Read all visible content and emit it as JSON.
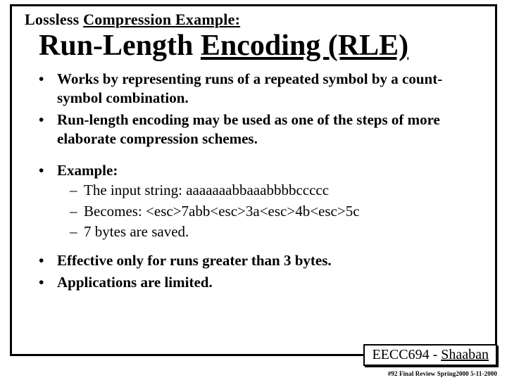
{
  "supertitle_plain": "Lossless ",
  "supertitle_under": "Compression Example:",
  "title_plain": "Run-Length ",
  "title_under": "Encoding (RLE)",
  "bullets": {
    "b1": "Works by representing runs of a repeated symbol by a count-symbol combination.",
    "b2": "Run-length encoding may be used as one of the steps of more elaborate compression schemes.",
    "b3": "Example:",
    "b3_sub": {
      "s1": "The input string:   aaaaaaabbaaabbbbccccc",
      "s2": "Becomes: <esc>7abb<esc>3a<esc>4b<esc>5c",
      "s3": "7 bytes are saved."
    },
    "b4": "Effective only for runs greater than 3 bytes.",
    "b5": "Applications are limited."
  },
  "footer": {
    "course": "EECC694 - ",
    "author": "Shaaban",
    "note": "#92  Final Review   Spring2000   5-11-2000"
  }
}
